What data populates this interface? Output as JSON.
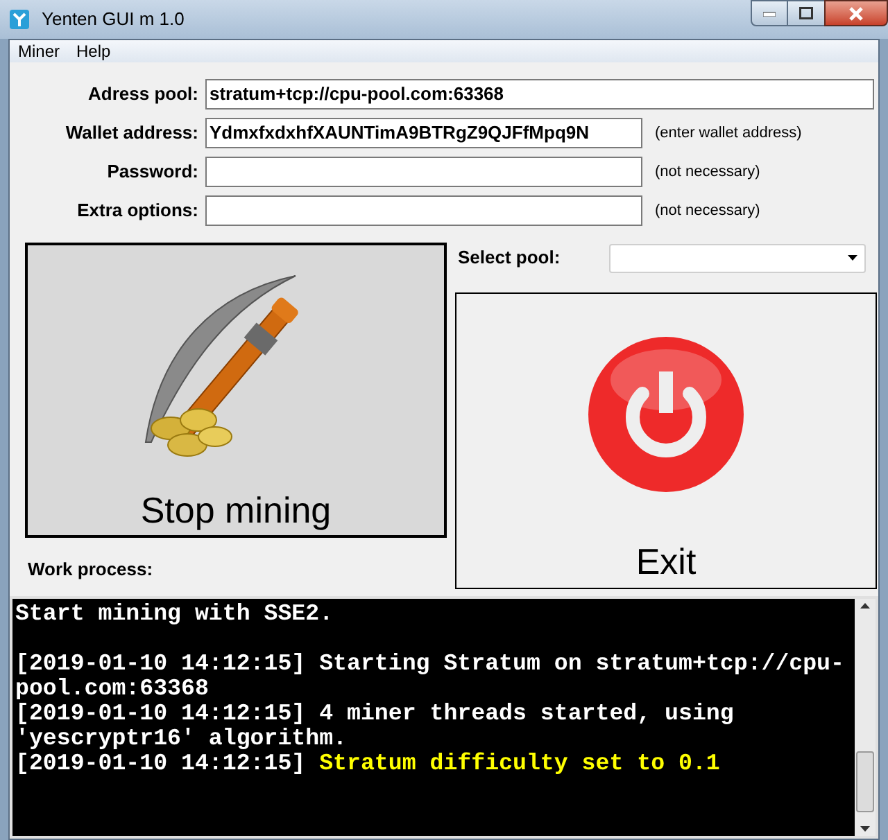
{
  "window": {
    "title": "Yenten GUI m 1.0"
  },
  "menu": [
    "Miner",
    "Help"
  ],
  "fields": [
    {
      "label": "Adress pool:",
      "value": "stratum+tcp://cpu-pool.com:63368"
    },
    {
      "label": "Wallet address:",
      "value": "YdmxfxdxhfXAUNTimA9BTRgZ9QJFfMpq9N",
      "hint": "(enter wallet address)"
    },
    {
      "label": "Password:",
      "hint": "(not necessary)"
    },
    {
      "label": "Extra options:",
      "hint": "(not necessary)"
    }
  ],
  "mining_button": {
    "label": "Stop mining"
  },
  "select_pool": {
    "label": "Select pool:"
  },
  "exit_button": {
    "label": "Exit"
  },
  "work_process": {
    "label": "Work process:"
  },
  "log": [
    {
      "kind": "message",
      "text": "Start mining with SSE2.",
      "highlight": false
    },
    {
      "kind": "blank"
    },
    {
      "kind": "message",
      "timestamp": "[2019-01-10 14:12:15]",
      "text": "Starting Stratum on stratum+tcp://cpu-pool.com:63368",
      "highlight": false
    },
    {
      "kind": "message",
      "timestamp": "[2019-01-10 14:12:15]",
      "text": "4 miner threads started, using 'yescryptr16' algorithm.",
      "highlight": false
    },
    {
      "kind": "message",
      "timestamp": "[2019-01-10 14:12:15]",
      "text": "Stratum difficulty set to 0.1",
      "highlight": true
    }
  ]
}
